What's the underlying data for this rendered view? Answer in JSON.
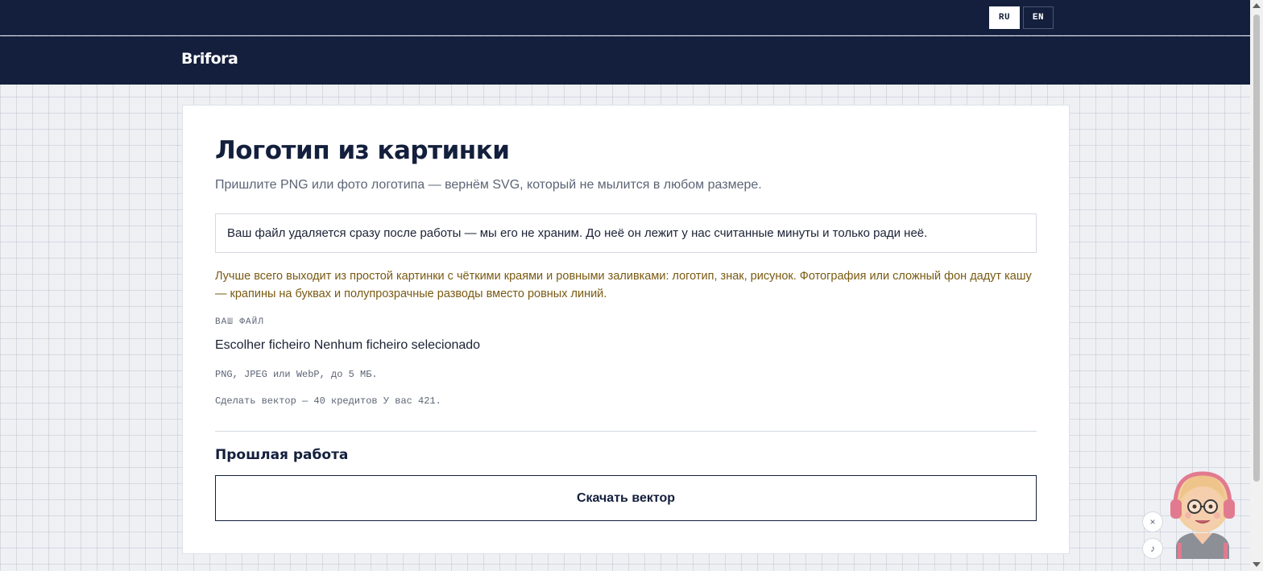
{
  "topbar": {
    "languages": [
      {
        "code": "RU",
        "active": true
      },
      {
        "code": "EN",
        "active": false
      }
    ]
  },
  "header": {
    "brand": "Brifora"
  },
  "main": {
    "title": "Логотип из картинки",
    "subtitle": "Пришлите PNG или фото логотипа — вернём SVG, который не мылится в любом размере.",
    "privacy_note": "Ваш файл удаляется сразу после работы — мы его не храним. До неё он лежит у нас считанные минуты и только ради неё.",
    "tip": "Лучше всего выходит из простой картинки с чёткими краями и ровными заливками: логотип, знак, рисунок. Фотография или сложный фон дадут кашу — крапины на буквах и полупрозрачные разводы вместо ровных линий.",
    "file_label": "ВАШ ФАЙЛ",
    "file_button": "Escolher ficheiro",
    "file_status": "Nenhum ficheiro selecionado",
    "file_hint": "PNG, JPEG или WebP, до 5 МБ.",
    "credits_text": "Сделать вектор — 40 кредитов У вас 421.",
    "past_work_title": "Прошлая работа",
    "download_label": "Скачать вектор"
  },
  "widget": {
    "close_icon": "×",
    "music_icon": "♪",
    "avatar": "avatar-with-headphones-icon"
  },
  "colors": {
    "navy": "#131f3c",
    "tip_text": "#7a5a12",
    "muted_text": "#5c6475",
    "page_background": "#eef0f4"
  }
}
